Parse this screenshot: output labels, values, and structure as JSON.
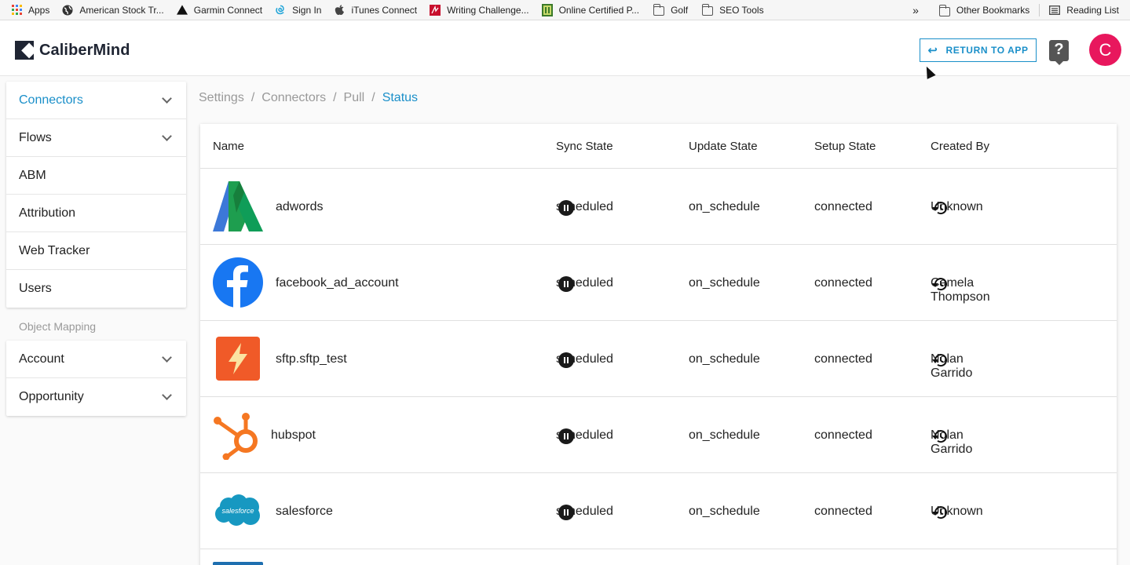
{
  "bookmarks": {
    "left": [
      {
        "label": "Apps",
        "icon": "apps-grid-icon"
      },
      {
        "label": "American Stock Tr...",
        "icon": "globe-icon"
      },
      {
        "label": "Garmin Connect",
        "icon": "garmin-triangle-icon"
      },
      {
        "label": "Sign In",
        "icon": "sign-in-swirl-icon"
      },
      {
        "label": "iTunes Connect",
        "icon": "apple-icon"
      },
      {
        "label": "Writing Challenge...",
        "icon": "writing-red-icon"
      },
      {
        "label": "Online Certified P...",
        "icon": "certified-green-icon"
      },
      {
        "label": "Golf",
        "icon": "folder-icon"
      },
      {
        "label": "SEO Tools",
        "icon": "folder-icon"
      }
    ],
    "overflow": "»",
    "other_label": "Other Bookmarks",
    "reading_list_label": "Reading List"
  },
  "header": {
    "app_name": "CaliberMind",
    "return_label": "RETURN TO APP",
    "return_icon": "↩",
    "help_icon": "?",
    "avatar_letter": "C",
    "avatar_color": "#e8175d",
    "accent_color": "#1a8fc9"
  },
  "sidebar": {
    "items": [
      {
        "label": "Connectors",
        "expandable": true,
        "active": true
      },
      {
        "label": "Flows",
        "expandable": true,
        "active": false
      },
      {
        "label": "ABM",
        "expandable": false,
        "active": false
      },
      {
        "label": "Attribution",
        "expandable": false,
        "active": false
      },
      {
        "label": "Web Tracker",
        "expandable": false,
        "active": false
      },
      {
        "label": "Users",
        "expandable": false,
        "active": false
      }
    ],
    "object_mapping_heading": "Object Mapping",
    "object_mapping_items": [
      {
        "label": "Account",
        "expandable": true
      },
      {
        "label": "Opportunity",
        "expandable": true
      }
    ]
  },
  "breadcrumb": {
    "items": [
      "Settings",
      "Connectors",
      "Pull"
    ],
    "current": "Status",
    "separator": "/"
  },
  "table": {
    "columns": [
      "Name",
      "Sync State",
      "Update State",
      "Setup State",
      "Created By"
    ],
    "rows": [
      {
        "name": "adwords",
        "logo": "google-ads-logo",
        "sync_state": "scheduled",
        "update_state": "on_schedule",
        "setup_state": "connected",
        "created_by": "Unknown"
      },
      {
        "name": "facebook_ad_account",
        "logo": "facebook-logo",
        "sync_state": "scheduled",
        "update_state": "on_schedule",
        "setup_state": "connected",
        "created_by": "Camela Thompson"
      },
      {
        "name": "sftp.sftp_test",
        "logo": "sftp-bolt-logo",
        "sync_state": "scheduled",
        "update_state": "on_schedule",
        "setup_state": "connected",
        "created_by": "Nolan Garrido"
      },
      {
        "name": "hubspot",
        "logo": "hubspot-logo",
        "sync_state": "scheduled",
        "update_state": "on_schedule",
        "setup_state": "connected",
        "created_by": "Nolan Garrido"
      },
      {
        "name": "salesforce",
        "logo": "salesforce-logo",
        "sync_state": "scheduled",
        "update_state": "on_schedule",
        "setup_state": "connected",
        "created_by": "Unknown"
      }
    ]
  }
}
